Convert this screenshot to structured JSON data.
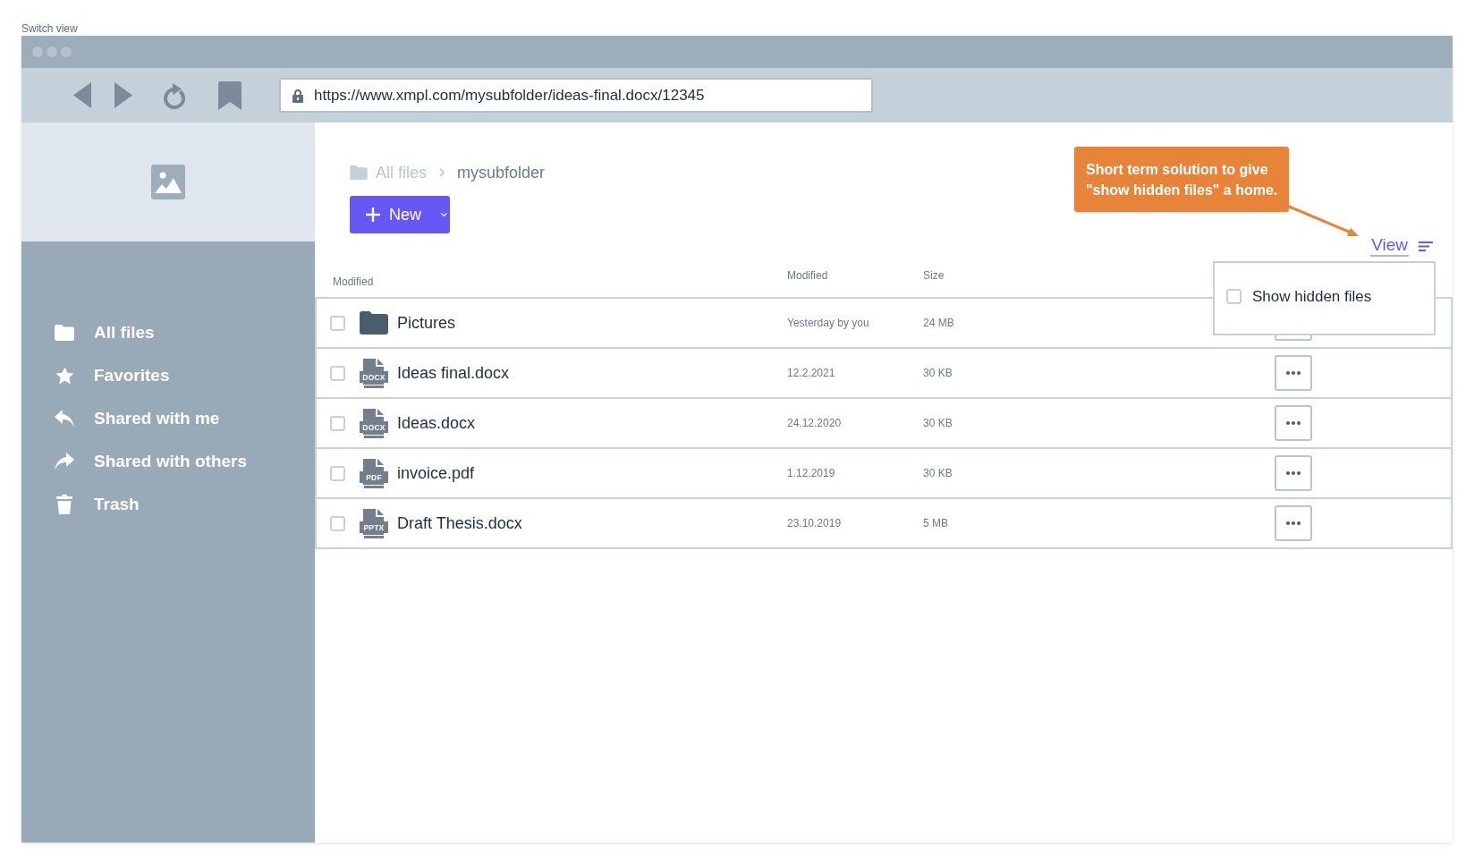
{
  "page_label": "Switch view",
  "browser": {
    "url": "https://www.xmpl.com/mysubfolder/ideas-final.docx/12345"
  },
  "sidebar": {
    "items": [
      {
        "label": "All files",
        "kind": "folder"
      },
      {
        "label": "Favorites",
        "kind": "star"
      },
      {
        "label": "Shared with me",
        "kind": "incoming"
      },
      {
        "label": "Shared with others",
        "kind": "outgoing"
      },
      {
        "label": "Trash",
        "kind": "trash"
      }
    ]
  },
  "breadcrumb": [
    {
      "label": "All files",
      "selected": false
    },
    {
      "label": "mysubfolder",
      "selected": true
    }
  ],
  "new_button": {
    "label": "New"
  },
  "callout": {
    "lines": [
      "Short term solution to give",
      "\"show hidden files\" a home."
    ]
  },
  "view_menu": {
    "label": "View",
    "options": [
      {
        "label": "Show hidden files",
        "checked": false
      }
    ]
  },
  "table": {
    "columns": [
      "Modified",
      "Modified",
      "Size"
    ],
    "rows": [
      {
        "name": "Pictures",
        "kind": "folder",
        "modified": "Yesterday by you",
        "size": "24 MB",
        "checked": false
      },
      {
        "name": "Ideas final.docx",
        "kind": "document",
        "badge": "DOCX",
        "modified": "12.2.2021",
        "size": "30 KB",
        "checked": false
      },
      {
        "name": "Ideas.docx",
        "kind": "document",
        "badge": "DOCX",
        "modified": "24.12.2020",
        "size": "30 KB",
        "checked": false
      },
      {
        "name": "invoice.pdf",
        "kind": "document",
        "badge": "PDF",
        "modified": "1.12.2019",
        "size": "30 KB",
        "checked": false
      },
      {
        "name": "Draft Thesis.docx",
        "kind": "document",
        "badge": "PPTX",
        "modified": "23.10.2019",
        "size": "5 MB",
        "checked": false
      }
    ]
  }
}
